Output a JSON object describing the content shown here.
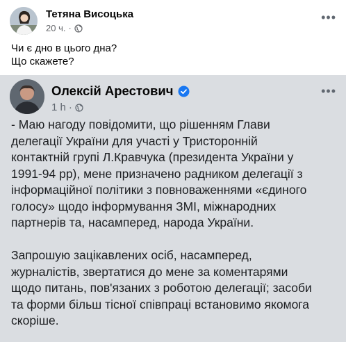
{
  "outer_post": {
    "author": "Тетяна Висоцька",
    "time": "20 ч.",
    "privacy_icon": "globe-icon",
    "menu_icon": "more-dots-icon",
    "text_lines": [
      "Чи є дно в цього дна?",
      "Що скажете?"
    ]
  },
  "shared_post": {
    "author": "Олексій Арестович",
    "verified_icon": "verified-badge-icon",
    "time": "1 h",
    "privacy_icon": "globe-icon",
    "menu_icon": "more-dots-icon",
    "paragraphs": [
      {
        "lines": [
          "- Маю нагоду повідомити, що рішенням Глави",
          "делегації України для участі у Тристоронній",
          "контактній групі Л.Кравчука (президента України у",
          "1991-94 рр), мене призначено радником делегації з",
          "інформаційної політики з повноваженнями «єдиного",
          "голосу» щодо інформування ЗМІ, міжнародних",
          "партнерів та, насамперед, народа України."
        ]
      },
      {
        "lines": [
          "Запрошую зацікавлених осіб, насамперед,",
          "журналістів, звертатися до мене за коментарями",
          "щодо питань, пов'язаних з роботою делегації; засоби",
          "та форми більш тісної співпраці встановимо якомога",
          "скоріше."
        ]
      }
    ]
  },
  "colors": {
    "shared_background": "#dadde1",
    "verified_blue": "#1877f2",
    "meta_gray": "#65676b"
  }
}
